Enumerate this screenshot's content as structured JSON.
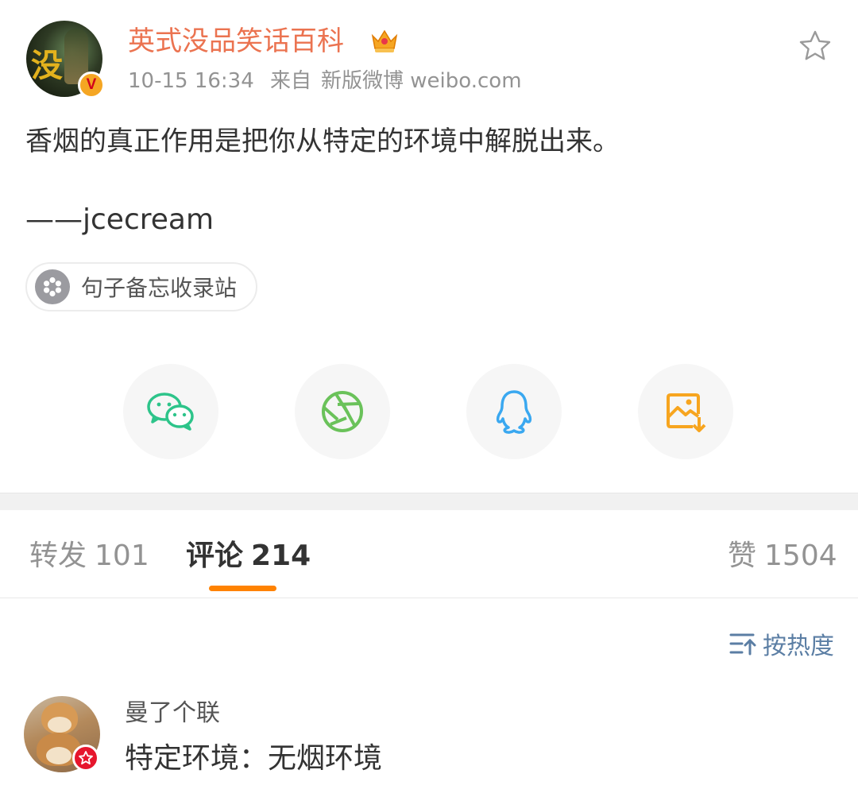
{
  "post": {
    "author": {
      "name": "英式没品笑话百科",
      "avatar_art_text": "没",
      "verified_badge": "V",
      "crown_icon": "crown-icon"
    },
    "timestamp": "10-15 16:34",
    "source_prefix": "来自",
    "source": "新版微博 weibo.com",
    "text": "香烟的真正作用是把你从特定的环境中解脱出来。",
    "signature": "——jcecream",
    "topic": {
      "icon": "flower-icon",
      "label": "句子备忘收录站"
    },
    "favorite_icon": "star-outline-icon"
  },
  "share": [
    {
      "name": "wechat",
      "icon": "wechat-icon",
      "color": "#2dc48a"
    },
    {
      "name": "moments",
      "icon": "moments-aperture-icon",
      "color": "#6ac25a"
    },
    {
      "name": "qq",
      "icon": "qq-penguin-icon",
      "color": "#3aa8f0"
    },
    {
      "name": "save-image",
      "icon": "save-image-icon",
      "color": "#f7a51f"
    }
  ],
  "tabs": {
    "repost": {
      "label": "转发",
      "count": "101"
    },
    "comments": {
      "label": "评论",
      "count": "214"
    },
    "likes": {
      "label": "赞",
      "count": "1504"
    }
  },
  "sort": {
    "label": "按热度",
    "icon": "sort-icon"
  },
  "comments": [
    {
      "user": "曼了个联",
      "text": "特定环境：无烟环境",
      "badge_icon": "star-badge-icon"
    }
  ],
  "colors": {
    "username": "#eb7350",
    "accent": "#ff8200",
    "link": "#5b7ea4",
    "muted": "#939393"
  }
}
